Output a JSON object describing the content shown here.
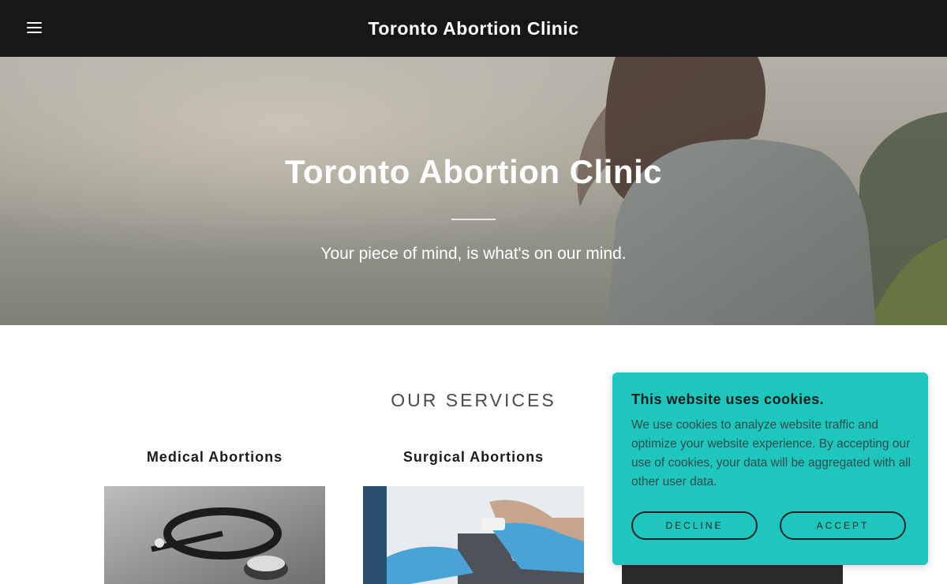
{
  "header": {
    "menu_icon": "hamburger-menu-icon",
    "site_title": "Toronto Abortion Clinic"
  },
  "hero": {
    "title": "Toronto Abortion Clinic",
    "subtitle": "Your piece of mind, is what's on our mind."
  },
  "services": {
    "heading": "OUR SERVICES",
    "cards": [
      {
        "title": "Medical Abortions"
      },
      {
        "title": "Surgical Abortions"
      }
    ]
  },
  "cookie_banner": {
    "title": "This website uses cookies.",
    "text": "We use cookies to analyze website traffic and optimize your website experience. By accepting our use of cookies, your data will be aggregated with all other user data.",
    "decline_label": "DECLINE",
    "accept_label": "ACCEPT"
  },
  "colors": {
    "header_bg": "#171717",
    "cookie_bg": "#1fc6be",
    "text_dark": "#1b1b1b"
  }
}
